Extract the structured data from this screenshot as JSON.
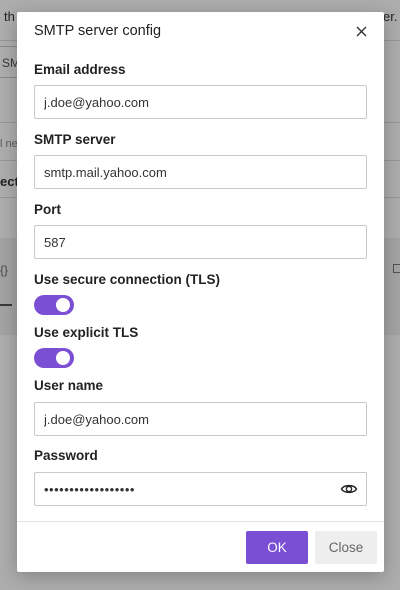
{
  "background": {
    "top_left_text": "th",
    "top_right_text": "er.",
    "field_prefix": "SM",
    "hint_prefix": "l ne",
    "bold_prefix": "ect",
    "braces": "{}"
  },
  "dialog": {
    "title": "SMTP server config",
    "close_icon": "close-icon",
    "fields": {
      "email": {
        "label": "Email address",
        "value": "j.doe@yahoo.com"
      },
      "smtp_server": {
        "label": "SMTP server",
        "value": "smtp.mail.yahoo.com"
      },
      "port": {
        "label": "Port",
        "value": "587"
      },
      "use_tls": {
        "label": "Use secure connection (TLS)",
        "enabled": true
      },
      "explicit_tls": {
        "label": "Use explicit TLS",
        "enabled": true
      },
      "user_name": {
        "label": "User name",
        "value": "j.doe@yahoo.com"
      },
      "password": {
        "label": "Password",
        "value": "••••••••••••••••••",
        "icon": "eye-icon"
      }
    },
    "buttons": {
      "ok": "OK",
      "close": "Close"
    }
  },
  "colors": {
    "accent": "#7b4fd4",
    "overlay": "rgba(0,0,0,0.32)"
  }
}
